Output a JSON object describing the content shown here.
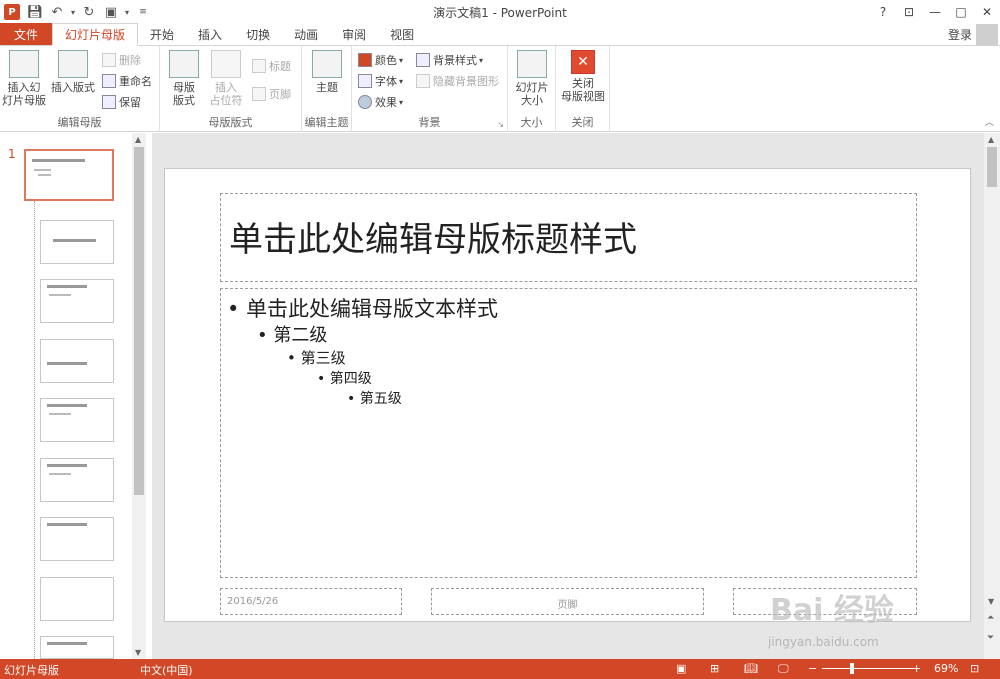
{
  "app_icon": "P",
  "window_title": "演示文稿1 - PowerPoint",
  "window_buttons": [
    "?",
    "⊡",
    "—",
    "□",
    "✕"
  ],
  "login": "登录",
  "tabs": [
    "文件",
    "幻灯片母版",
    "开始",
    "插入",
    "切换",
    "动画",
    "审阅",
    "视图"
  ],
  "ribbon": {
    "group_edit_master": {
      "name": "编辑母版",
      "insert_slide_master": "插入幻\n灯片母版",
      "insert_layout": "插入版式",
      "delete": "删除",
      "rename": "重命名",
      "preserve": "保留"
    },
    "group_master_layout": {
      "name": "母版版式",
      "master_layout": "母版\n版式",
      "insert_placeholder": "插入\n占位符",
      "title": "标题",
      "footer": "页脚"
    },
    "group_edit_theme": {
      "name": "编辑主题",
      "themes": "主题"
    },
    "group_background": {
      "name": "背景",
      "colors": "颜色",
      "fonts": "字体",
      "effects": "效果",
      "bg_styles": "背景样式",
      "hide_bg": "隐藏背景图形"
    },
    "group_size": {
      "name": "大小",
      "slide_size": "幻灯片\n大小"
    },
    "group_close": {
      "name": "关闭",
      "close_master": "关闭\n母版视图"
    }
  },
  "thumbnail_number": "1",
  "slide": {
    "title": "单击此处编辑母版标题样式",
    "level1": "单击此处编辑母版文本样式",
    "level2": "第二级",
    "level3": "第三级",
    "level4": "第四级",
    "level5": "第五级",
    "footer_date": "2016/5/26",
    "footer_text": "页脚"
  },
  "status": {
    "view": "幻灯片母版",
    "language": "中文(中国)",
    "zoom": "69%",
    "zoom_value": 0.69
  },
  "watermark": {
    "main": "Bai 经验",
    "url": "jingyan.baidu.com"
  },
  "colors": {
    "accent": "#d24726"
  }
}
